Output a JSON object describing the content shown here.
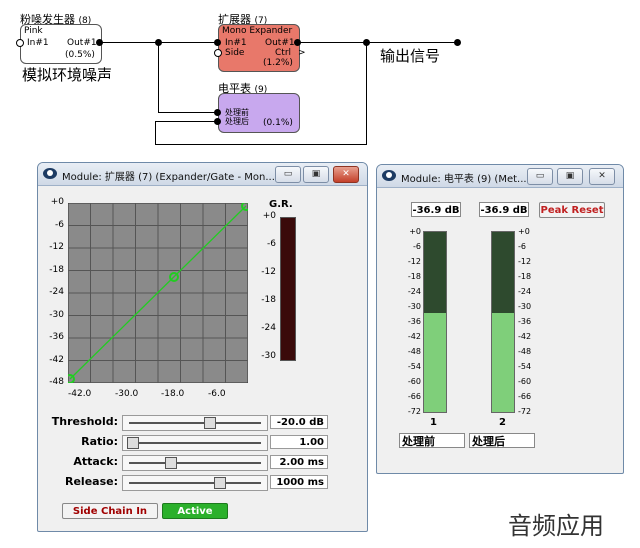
{
  "diagram": {
    "pink_block": {
      "title": "粉噪发生器",
      "count": "(8)",
      "name": "Pink",
      "in": "In#1",
      "out": "Out#1",
      "value": "(0.5%)"
    },
    "expander_block": {
      "title": "扩展器",
      "count": "(7)",
      "name": "Mono Expander",
      "in": "In#1",
      "side": "Side",
      "out": "Out#1",
      "ctrl": "Ctrl",
      "value": "(1.2%)"
    },
    "meter_block": {
      "title": "电平表",
      "count": "(9)",
      "in1": "处理前",
      "in2": "处理后",
      "value": "(0.1%)"
    },
    "annot_noise": "模拟环境噪声",
    "annot_output": "输出信号"
  },
  "expander_window": {
    "title": "Module: 扩展器 (7) (Expander/Gate - Mon...",
    "graph_yticks": [
      "+0",
      "-6",
      "-12",
      "-18",
      "-24",
      "-30",
      "-36",
      "-42",
      "-48"
    ],
    "graph_xticks": [
      "-42.0",
      "-30.0",
      "-18.0",
      "-6.0"
    ],
    "gr_label": "G.R.",
    "gr_ticks": [
      "+0",
      "-6",
      "-12",
      "-18",
      "-24",
      "-30"
    ],
    "params": [
      {
        "label": "Threshold:",
        "value": "-20.0 dB",
        "pos": 0.6
      },
      {
        "label": "Ratio:",
        "value": "1.00",
        "pos": 0.0
      },
      {
        "label": "Attack:",
        "value": "2.00 ms",
        "pos": 0.3
      },
      {
        "label": "Release:",
        "value": "1000 ms",
        "pos": 0.68
      }
    ],
    "side_chain_label": "Side Chain In",
    "active_label": "Active"
  },
  "meter_window": {
    "title": "Module: 电平表 (9) (Met...",
    "readout1": "-36.9 dB",
    "readout2": "-36.9 dB",
    "peak_reset": "Peak Reset",
    "ticks": [
      "+0",
      "-6",
      "-12",
      "-18",
      "-24",
      "-30",
      "-36",
      "-42",
      "-48",
      "-54",
      "-60",
      "-66",
      "-72"
    ],
    "ch1_number": "1",
    "ch2_number": "2",
    "ch1_label": "处理前",
    "ch2_label": "处理后",
    "level_fraction": 0.55
  },
  "watermark": "音频应用",
  "colors": {
    "expander_block": "#e8786a",
    "meter_block": "#c8a8ee",
    "pink_block": "#ffffff",
    "active": "#2bb02b",
    "meter_green": "#7fcf7a",
    "graph_bg": "#8a8a8a",
    "curve": "#22cc22"
  }
}
